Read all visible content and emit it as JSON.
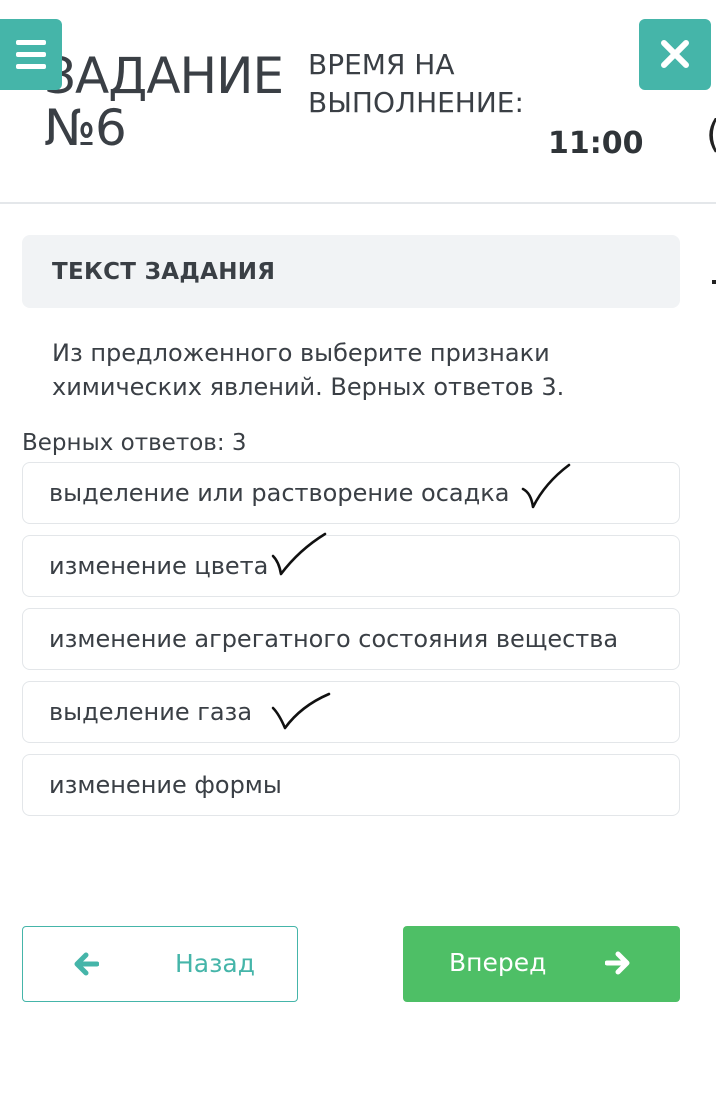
{
  "header": {
    "task_title": "ЗАДАНИЕ №6",
    "time_label": "ВРЕМЯ НА ВЫПОЛНЕНИЕ:",
    "time_value": "11:00",
    "edge_char": "("
  },
  "task": {
    "box_title": "ТЕКСТ ЗАДАНИЯ",
    "question": "Из предложенного выберите признаки химических явлений. Верных ответов 3.",
    "answers_count": "Верных ответов: 3"
  },
  "options": [
    {
      "label": "выделение или растворение осадка",
      "checked": true
    },
    {
      "label": "изменение цвета",
      "checked": true
    },
    {
      "label": "изменение агрегатного состояния вещества",
      "checked": false
    },
    {
      "label": "выделение газа",
      "checked": true
    },
    {
      "label": "изменение формы",
      "checked": false
    }
  ],
  "nav": {
    "back_label": "Назад",
    "next_label": "Вперед"
  },
  "colors": {
    "accent_teal": "#45b5a9",
    "next_green": "#4ebf66",
    "text_dark": "#3a3f45",
    "panel_gray": "#f1f3f5"
  },
  "icons": {
    "menu": "hamburger-menu-icon",
    "close": "close-icon",
    "back": "arrow-left-icon",
    "next": "arrow-right-icon",
    "check": "handwritten-check-icon"
  }
}
